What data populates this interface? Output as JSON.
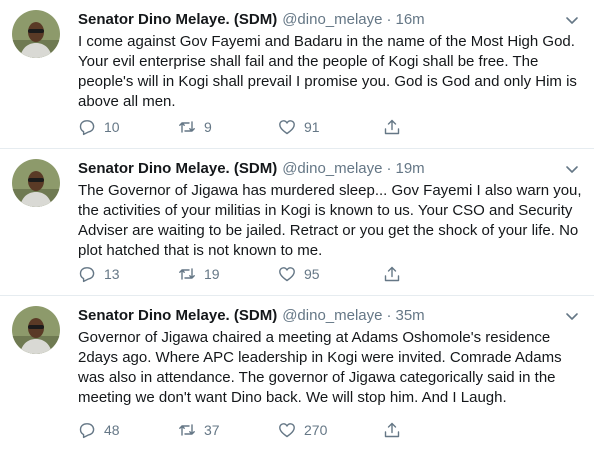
{
  "tweets": [
    {
      "name": "Senator Dino Melaye. (SDM)",
      "handle": "@dino_melaye",
      "separator": "·",
      "time": "16m",
      "text": "I come against Gov Fayemi and Badaru in the name of the Most High God. Your evil enterprise shall fail and the people of Kogi shall be free. The people's will in Kogi shall prevail I promise you. God is God and only Him is above all men.",
      "replies": "10",
      "retweets": "9",
      "likes": "91"
    },
    {
      "name": "Senator Dino Melaye. (SDM)",
      "handle": "@dino_melaye",
      "separator": "·",
      "time": "19m",
      "text": "The Governor of Jigawa has murdered sleep... Gov Fayemi I also warn you, the activities of your militias in Kogi is known to us. Your CSO and Security Adviser are waiting to be jailed. Retract or you get the shock of your life. No plot hatched that is not known to me.",
      "replies": "13",
      "retweets": "19",
      "likes": "95"
    },
    {
      "name": "Senator Dino Melaye. (SDM)",
      "handle": "@dino_melaye",
      "separator": "·",
      "time": "35m",
      "text": "Governor of Jigawa chaired a meeting at Adams Oshomole's residence 2days ago. Where APC leadership in Kogi were invited. Comrade Adams was also in attendance. The governor of Jigawa categorically said in the meeting we don't want Dino back. We will stop him. And I Laugh.",
      "replies": "48",
      "retweets": "37",
      "likes": "270"
    }
  ],
  "icons": {
    "reply": "reply-icon",
    "retweet": "retweet-icon",
    "like": "heart-icon",
    "share": "share-icon",
    "menu": "chevron-down-icon"
  },
  "colors": {
    "text": "#14171a",
    "secondary": "#657786",
    "divider": "#e6ecf0"
  }
}
